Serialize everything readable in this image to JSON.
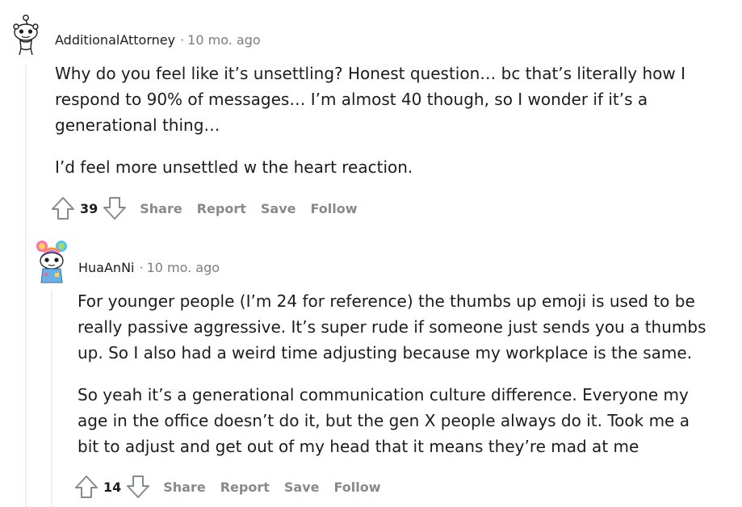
{
  "comments": [
    {
      "author": "AdditionalAttorney",
      "separator": "·",
      "time": "10 mo. ago",
      "paragraphs": [
        "Why do you feel like it’s unsettling? Honest question… bc that’s literally how I respond to 90% of messages… I’m almost 40 though, so I wonder if it’s a generational thing…",
        "I’d feel more unsettled w the heart reaction."
      ],
      "score": "39",
      "actions": {
        "share": "Share",
        "report": "Report",
        "save": "Save",
        "follow": "Follow"
      }
    },
    {
      "author": "HuaAnNi",
      "separator": "·",
      "time": "10 mo. ago",
      "paragraphs": [
        "For younger people (I’m 24 for reference) the thumbs up emoji is used to be really passive aggressive. It’s super rude if someone just sends you a thumbs up. So I also had a weird time adjusting because my workplace is the same.",
        "So yeah it’s a generational communication culture difference. Everyone my age in the office doesn’t do it, but the gen X people always do it. Took me a bit to adjust and get out of my head that it means they’re mad at me"
      ],
      "score": "14",
      "actions": {
        "share": "Share",
        "report": "Report",
        "save": "Save",
        "follow": "Follow"
      }
    }
  ],
  "icons": {
    "upvote": "upvote-arrow-icon",
    "downvote": "downvote-arrow-icon"
  },
  "colors": {
    "text": "#1c1c1c",
    "meta": "#7c7c7c",
    "action": "#878a8c",
    "thread_line": "#edeff1"
  }
}
